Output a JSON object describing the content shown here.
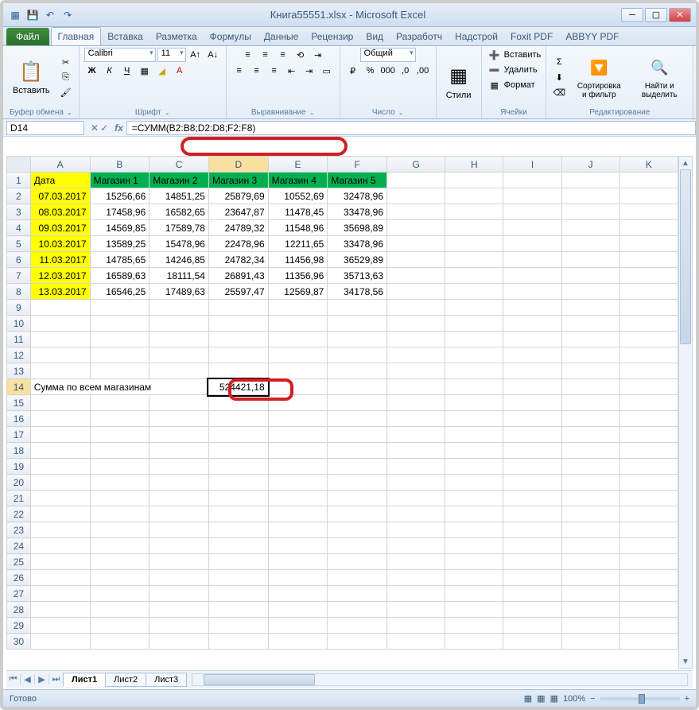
{
  "window": {
    "title": "Книга55551.xlsx - Microsoft Excel"
  },
  "ribbon": {
    "file": "Файл",
    "tabs": [
      "Главная",
      "Вставка",
      "Разметка",
      "Формулы",
      "Данные",
      "Рецензир",
      "Вид",
      "Разработч",
      "Надстрой",
      "Foxit PDF",
      "ABBYY PDF"
    ],
    "active_tab": 0,
    "clipboard": {
      "paste": "Вставить",
      "label": "Буфер обмена"
    },
    "font": {
      "name": "Calibri",
      "size": "11",
      "label": "Шрифт"
    },
    "alignment": {
      "label": "Выравнивание"
    },
    "number": {
      "format": "Общий",
      "label": "Число"
    },
    "styles": {
      "btn": "Стили",
      "label": ""
    },
    "cells": {
      "insert": "Вставить",
      "delete": "Удалить",
      "format": "Формат",
      "label": "Ячейки"
    },
    "editing": {
      "sort": "Сортировка и фильтр",
      "find": "Найти и выделить",
      "label": "Редактирование"
    }
  },
  "formula_bar": {
    "name_box": "D14",
    "formula": "=СУММ(B2:B8;D2:D8;F2:F8)"
  },
  "columns": [
    "A",
    "B",
    "C",
    "D",
    "E",
    "F",
    "G",
    "H",
    "I",
    "J",
    "K"
  ],
  "headers": [
    "Дата",
    "Магазин 1",
    "Магазин 2",
    "Магазин 3",
    "Магазин 4",
    "Магазин 5"
  ],
  "data_rows": [
    {
      "date": "07.03.2017",
      "vals": [
        "15256,66",
        "14851,25",
        "25879,69",
        "10552,69",
        "32478,96"
      ]
    },
    {
      "date": "08.03.2017",
      "vals": [
        "17458,96",
        "16582,65",
        "23647,87",
        "11478,45",
        "33478,96"
      ]
    },
    {
      "date": "09.03.2017",
      "vals": [
        "14569,85",
        "17589,78",
        "24789,32",
        "11548,96",
        "35698,89"
      ]
    },
    {
      "date": "10.03.2017",
      "vals": [
        "13589,25",
        "15478,96",
        "22478,96",
        "12211,65",
        "33478,96"
      ]
    },
    {
      "date": "11.03.2017",
      "vals": [
        "14785,65",
        "14246,85",
        "24782,34",
        "11456,98",
        "36529,89"
      ]
    },
    {
      "date": "12.03.2017",
      "vals": [
        "16589,63",
        "18111,54",
        "26891,43",
        "11356,96",
        "35713,63"
      ]
    },
    {
      "date": "13.03.2017",
      "vals": [
        "16546,25",
        "17489,63",
        "25597,47",
        "12569,87",
        "34178,56"
      ]
    }
  ],
  "sum_row": {
    "label": "Сумма по всем магазинам",
    "value": "524421,18"
  },
  "sheets": {
    "tabs": [
      "Лист1",
      "Лист2",
      "Лист3"
    ],
    "active": 0
  },
  "status": {
    "ready": "Готово",
    "zoom": "100%"
  }
}
